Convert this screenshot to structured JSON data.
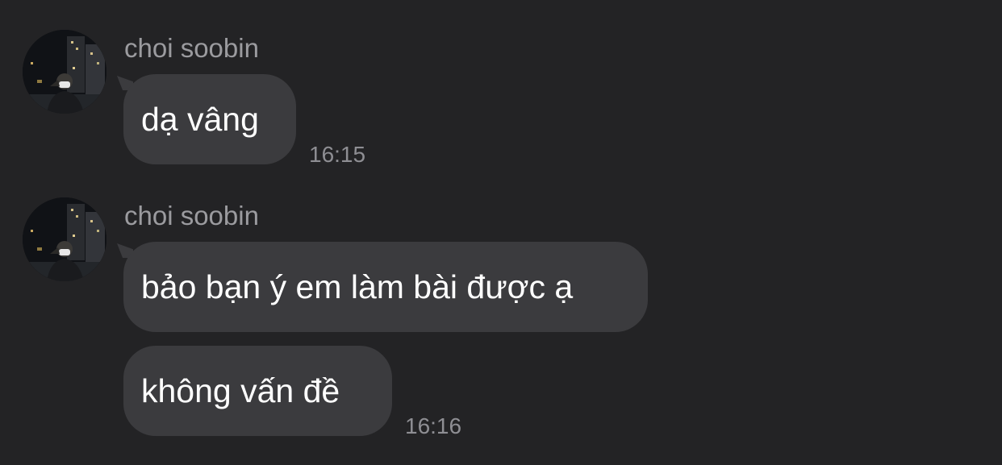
{
  "messages": [
    {
      "sender": "choi soobin",
      "avatar_icon": "profile-photo",
      "bubbles": [
        "dạ vâng"
      ],
      "time": "16:15"
    },
    {
      "sender": "choi soobin",
      "avatar_icon": "profile-photo",
      "bubbles": [
        "bảo bạn ý em làm bài được ạ",
        "không vấn đề"
      ],
      "time": "16:16"
    }
  ],
  "colors": {
    "background": "#232325",
    "bubble": "#3b3b3e",
    "sender_text": "#9b9b9f",
    "time_text": "#8e8e93",
    "message_text": "#ffffff"
  }
}
